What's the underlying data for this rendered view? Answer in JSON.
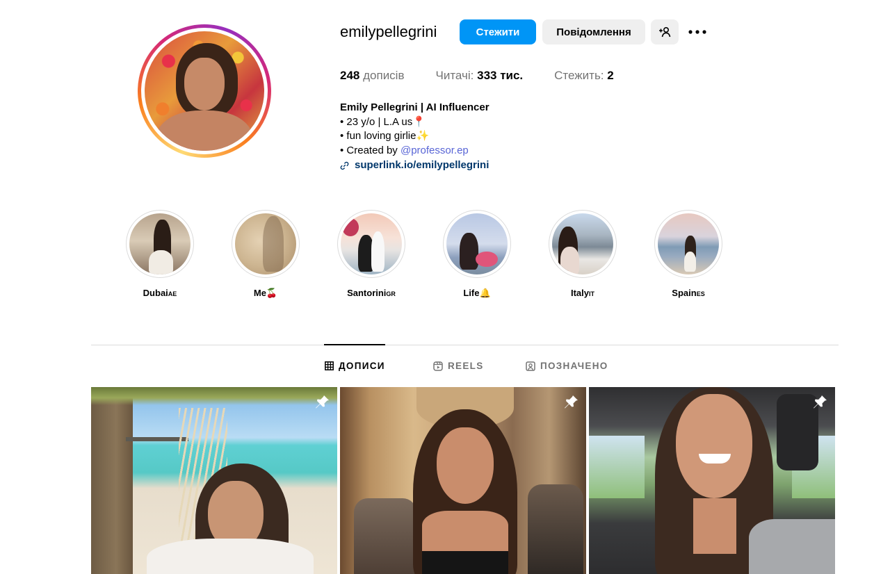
{
  "profile": {
    "username": "emilypellegrini",
    "follow_label": "Стежити",
    "message_label": "Повідомлення",
    "add_user_icon": "add-user-icon",
    "more_icon": "more-options-icon",
    "stats": {
      "posts_count": "248",
      "posts_label": "дописів",
      "followers_label": "Читачі:",
      "followers_count": "333 тис.",
      "following_label": "Стежить:",
      "following_count": "2"
    },
    "bio": {
      "name": "Emily Pellegrini | AI Influencer",
      "line1": "• 23 y/o | L.A us📍",
      "line2": "• fun loving girlie✨",
      "line3_prefix": "• Created by ",
      "mention": "@professor.ep",
      "link": "superlink.io/emilypellegrini"
    }
  },
  "highlights": [
    {
      "label": "Dubai",
      "suffix": "AE"
    },
    {
      "label": "Me🍒",
      "suffix": ""
    },
    {
      "label": "Santorini",
      "suffix": "GR"
    },
    {
      "label": "Life🔔",
      "suffix": ""
    },
    {
      "label": "Italy",
      "suffix": "IT"
    },
    {
      "label": "Spain",
      "suffix": "ES"
    }
  ],
  "tabs": {
    "posts": "ДОПИСИ",
    "reels": "REELS",
    "tagged": "ПОЗНАЧЕНО"
  },
  "colors": {
    "accent": "#0095f6",
    "secondary_button": "#efefef",
    "mention": "#5865d6",
    "link": "#00376b",
    "muted": "#737373"
  }
}
